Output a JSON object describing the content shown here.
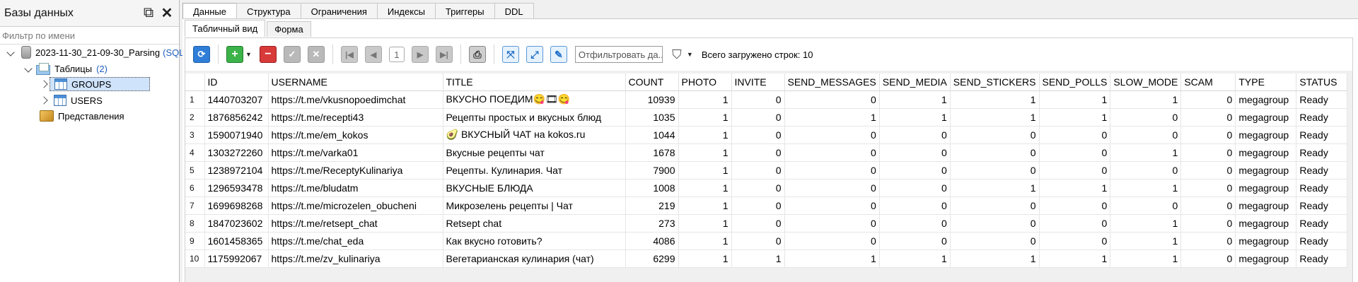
{
  "left_panel": {
    "title": "Базы данных",
    "filter_placeholder": "Фильтр по имени",
    "db_name": "2023-11-30_21-09-30_Parsing",
    "db_badge": "(SQL",
    "tables_label": "Таблицы",
    "tables_count": "(2)",
    "table_groups": "GROUPS",
    "table_users": "USERS",
    "views_label": "Представления"
  },
  "tabs": [
    "Данные",
    "Структура",
    "Ограничения",
    "Индексы",
    "Триггеры",
    "DDL"
  ],
  "subtabs": [
    "Табличный вид",
    "Форма"
  ],
  "toolbar": {
    "page": "1",
    "filter_placeholder": "Отфильтровать да...",
    "rows_loaded": "Всего загружено строк: 10"
  },
  "grid": {
    "columns": [
      "ID",
      "USERNAME",
      "TITLE",
      "COUNT",
      "PHOTO",
      "INVITE",
      "SEND_MESSAGES",
      "SEND_MEDIA",
      "SEND_STICKERS",
      "SEND_POLLS",
      "SLOW_MODE",
      "SCAM",
      "TYPE",
      "STATUS"
    ],
    "rows": [
      {
        "n": "1",
        "id": "1440703207",
        "username": "https://t.me/vkusnopoedimchat",
        "title": "ВКУСНО ПОЕДИМ",
        "title_emoji": "😋🎞😋",
        "count": "10939",
        "photo": "1",
        "invite": "0",
        "send_messages": "0",
        "send_media": "1",
        "send_stickers": "1",
        "send_polls": "1",
        "slow_mode": "1",
        "scam": "0",
        "type": "megagroup",
        "status": "Ready"
      },
      {
        "n": "2",
        "id": "1876856242",
        "username": "https://t.me/recepti43",
        "title": "Рецепты простых и вкусных блюд",
        "count": "1035",
        "photo": "1",
        "invite": "0",
        "send_messages": "1",
        "send_media": "1",
        "send_stickers": "1",
        "send_polls": "1",
        "slow_mode": "0",
        "scam": "0",
        "type": "megagroup",
        "status": "Ready"
      },
      {
        "n": "3",
        "id": "1590071940",
        "username": "https://t.me/em_kokos",
        "title": "ВКУСНЫЙ ЧАТ на kokos.ru",
        "title_prefix_emoji": "🥑",
        "count": "1044",
        "photo": "1",
        "invite": "0",
        "send_messages": "0",
        "send_media": "0",
        "send_stickers": "0",
        "send_polls": "0",
        "slow_mode": "0",
        "scam": "0",
        "type": "megagroup",
        "status": "Ready"
      },
      {
        "n": "4",
        "id": "1303272260",
        "username": "https://t.me/varka01",
        "title": "Вкусные рецепты чат",
        "count": "1678",
        "photo": "1",
        "invite": "0",
        "send_messages": "0",
        "send_media": "0",
        "send_stickers": "0",
        "send_polls": "0",
        "slow_mode": "1",
        "scam": "0",
        "type": "megagroup",
        "status": "Ready"
      },
      {
        "n": "5",
        "id": "1238972104",
        "username": "https://t.me/ReceptyKulinariya",
        "title": "Рецепты. Кулинария. Чат",
        "count": "7900",
        "photo": "1",
        "invite": "0",
        "send_messages": "0",
        "send_media": "0",
        "send_stickers": "0",
        "send_polls": "0",
        "slow_mode": "0",
        "scam": "0",
        "type": "megagroup",
        "status": "Ready"
      },
      {
        "n": "6",
        "id": "1296593478",
        "username": "https://t.me/bludatm",
        "title": "ВКУСНЫЕ БЛЮДА",
        "count": "1008",
        "photo": "1",
        "invite": "0",
        "send_messages": "0",
        "send_media": "0",
        "send_stickers": "1",
        "send_polls": "1",
        "slow_mode": "1",
        "scam": "0",
        "type": "megagroup",
        "status": "Ready"
      },
      {
        "n": "7",
        "id": "1699698268",
        "username": "https://t.me/microzelen_obucheni",
        "title": "Микрозелень рецепты | Чат",
        "count": "219",
        "photo": "1",
        "invite": "0",
        "send_messages": "0",
        "send_media": "0",
        "send_stickers": "0",
        "send_polls": "0",
        "slow_mode": "0",
        "scam": "0",
        "type": "megagroup",
        "status": "Ready"
      },
      {
        "n": "8",
        "id": "1847023602",
        "username": "https://t.me/retsept_chat",
        "title": "Retsept chat",
        "count": "273",
        "photo": "1",
        "invite": "0",
        "send_messages": "0",
        "send_media": "0",
        "send_stickers": "0",
        "send_polls": "0",
        "slow_mode": "1",
        "scam": "0",
        "type": "megagroup",
        "status": "Ready"
      },
      {
        "n": "9",
        "id": "1601458365",
        "username": "https://t.me/chat_eda",
        "title": "Как вкусно готовить?",
        "count": "4086",
        "photo": "1",
        "invite": "0",
        "send_messages": "0",
        "send_media": "0",
        "send_stickers": "0",
        "send_polls": "0",
        "slow_mode": "1",
        "scam": "0",
        "type": "megagroup",
        "status": "Ready"
      },
      {
        "n": "10",
        "id": "1175992067",
        "username": "https://t.me/zv_kulinariya",
        "title": "Вегетарианская кулинария (чат)",
        "count": "6299",
        "photo": "1",
        "invite": "1",
        "send_messages": "1",
        "send_media": "1",
        "send_stickers": "1",
        "send_polls": "1",
        "slow_mode": "1",
        "scam": "0",
        "type": "megagroup",
        "status": "Ready"
      }
    ]
  }
}
